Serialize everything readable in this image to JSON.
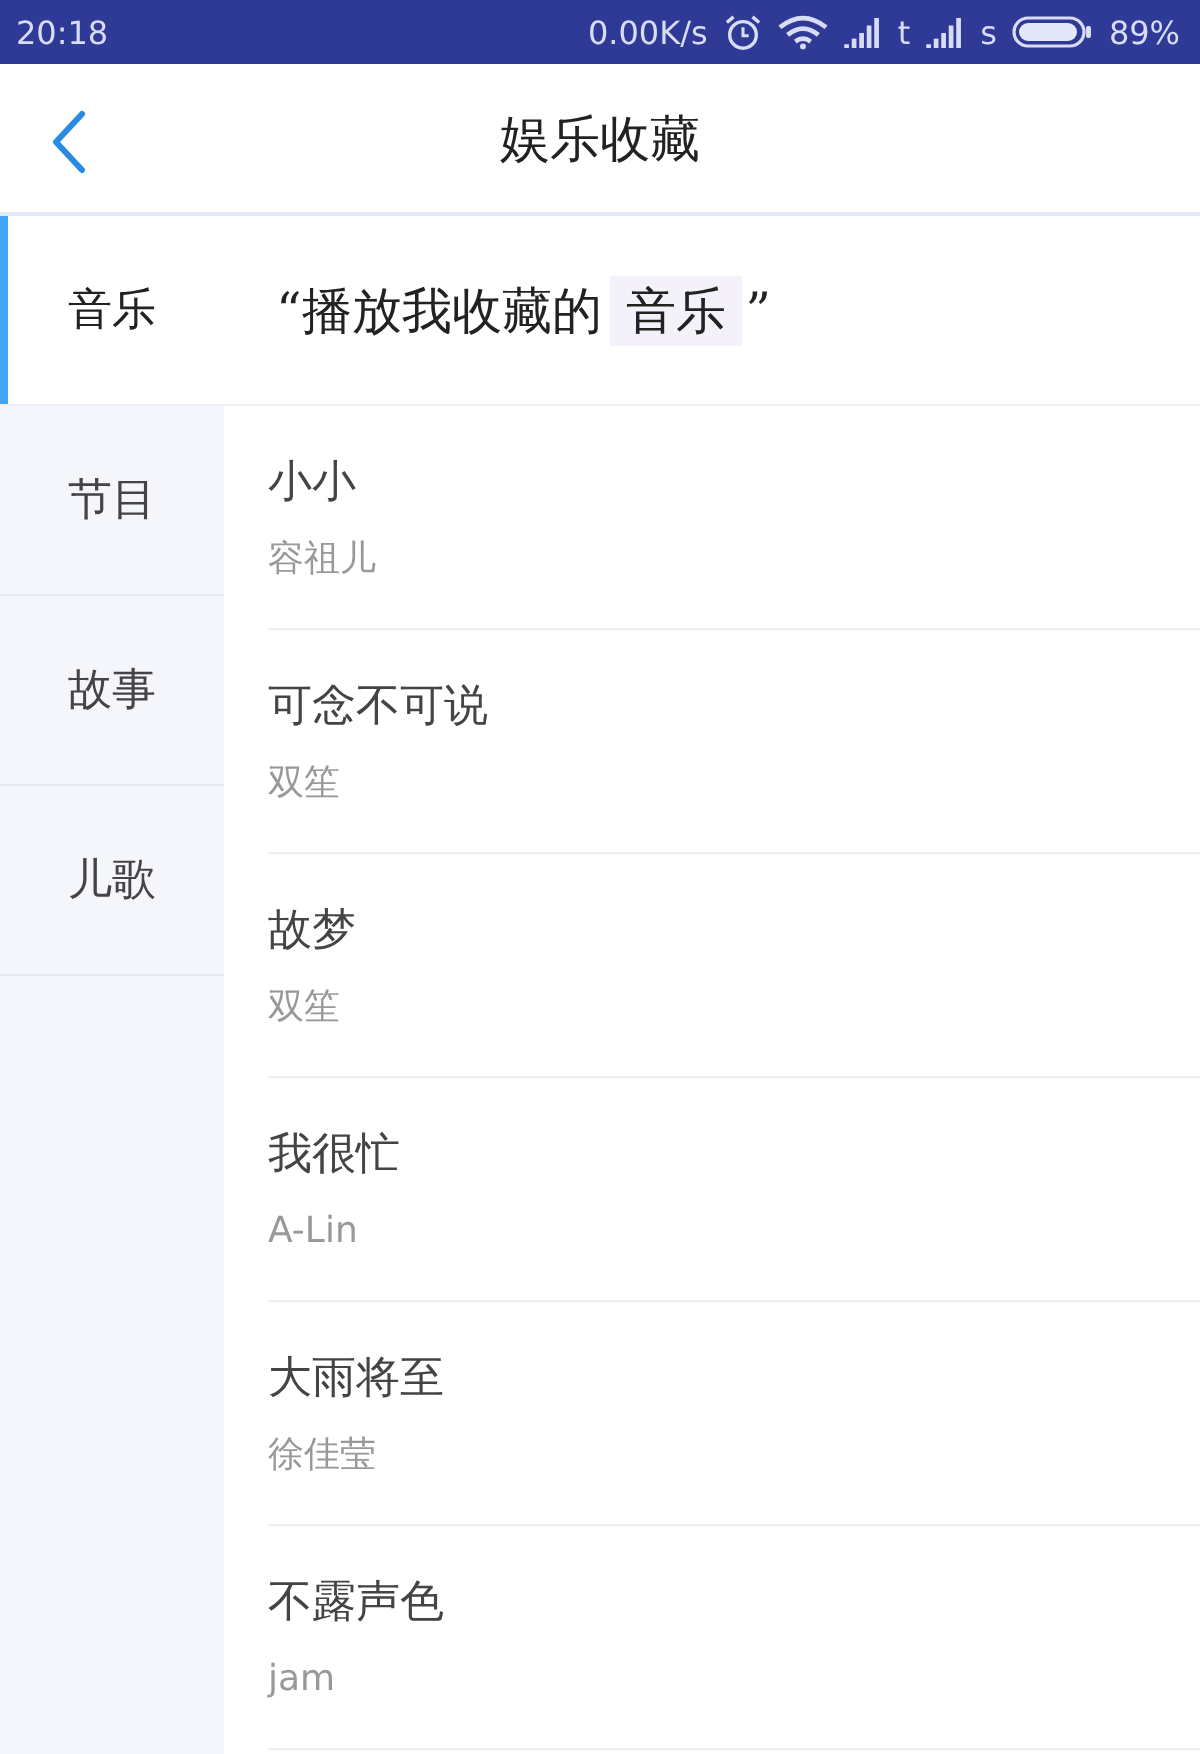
{
  "status_bar": {
    "time": "20:18",
    "net_speed": "0.00K/s",
    "carrier_1": "t",
    "carrier_2": "s",
    "battery": "89%"
  },
  "header": {
    "title": "娱乐收藏"
  },
  "sidebar": {
    "items": [
      {
        "label": "音乐",
        "selected": true
      },
      {
        "label": "节目",
        "selected": false
      },
      {
        "label": "故事",
        "selected": false
      },
      {
        "label": "儿歌",
        "selected": false
      }
    ]
  },
  "voice_hint": {
    "text": "“播放我收藏的",
    "keyword": "音乐",
    "close_quote": "”"
  },
  "songs": [
    {
      "title": "小小",
      "artist": "容祖儿"
    },
    {
      "title": "可念不可说",
      "artist": "双笙"
    },
    {
      "title": "故梦",
      "artist": "双笙"
    },
    {
      "title": "我很忙",
      "artist": "A-Lin"
    },
    {
      "title": "大雨将至",
      "artist": "徐佳莹"
    },
    {
      "title": "不露声色",
      "artist": "jam"
    }
  ]
}
